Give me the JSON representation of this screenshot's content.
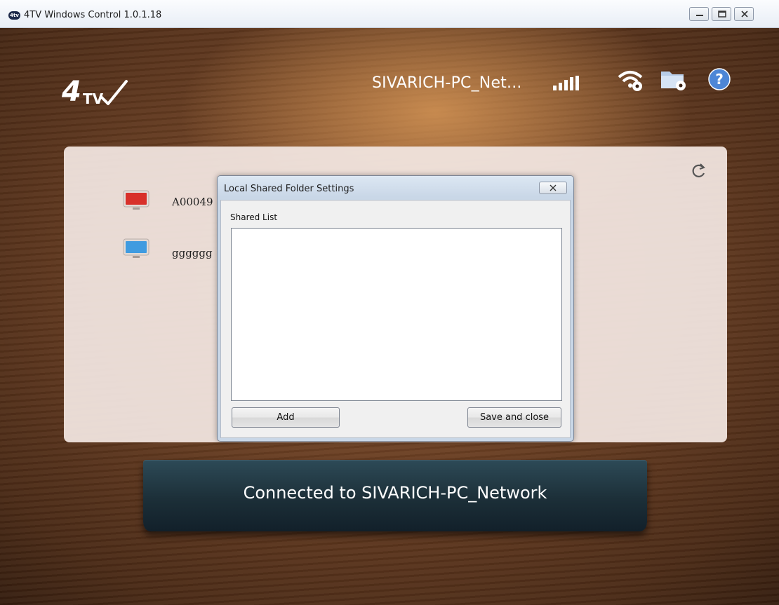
{
  "window": {
    "title": "4TV Windows Control 1.0.1.18",
    "app_icon_text": "4tv"
  },
  "header": {
    "logo_text": "4TV",
    "network_name": "SIVARICH-PC_Net...",
    "icons": [
      "signal-strength-icon",
      "wifi-settings-icon",
      "folder-settings-icon",
      "help-icon"
    ]
  },
  "devices": [
    {
      "name": "A00049",
      "icon": "tv-red-icon",
      "color": "#d8302a"
    },
    {
      "name": "gggggg",
      "icon": "tv-blue-icon",
      "color": "#3f9be0"
    }
  ],
  "dialog": {
    "title": "Local Shared Folder Settings",
    "list_label": "Shared List",
    "items": [],
    "add_label": "Add",
    "save_label": "Save and close"
  },
  "status": {
    "text": "Connected to SIVARICH-PC_Network"
  },
  "colors": {
    "panel": "#f0e4de",
    "banner": "#1c2f38",
    "accent": "#3f9be0"
  }
}
